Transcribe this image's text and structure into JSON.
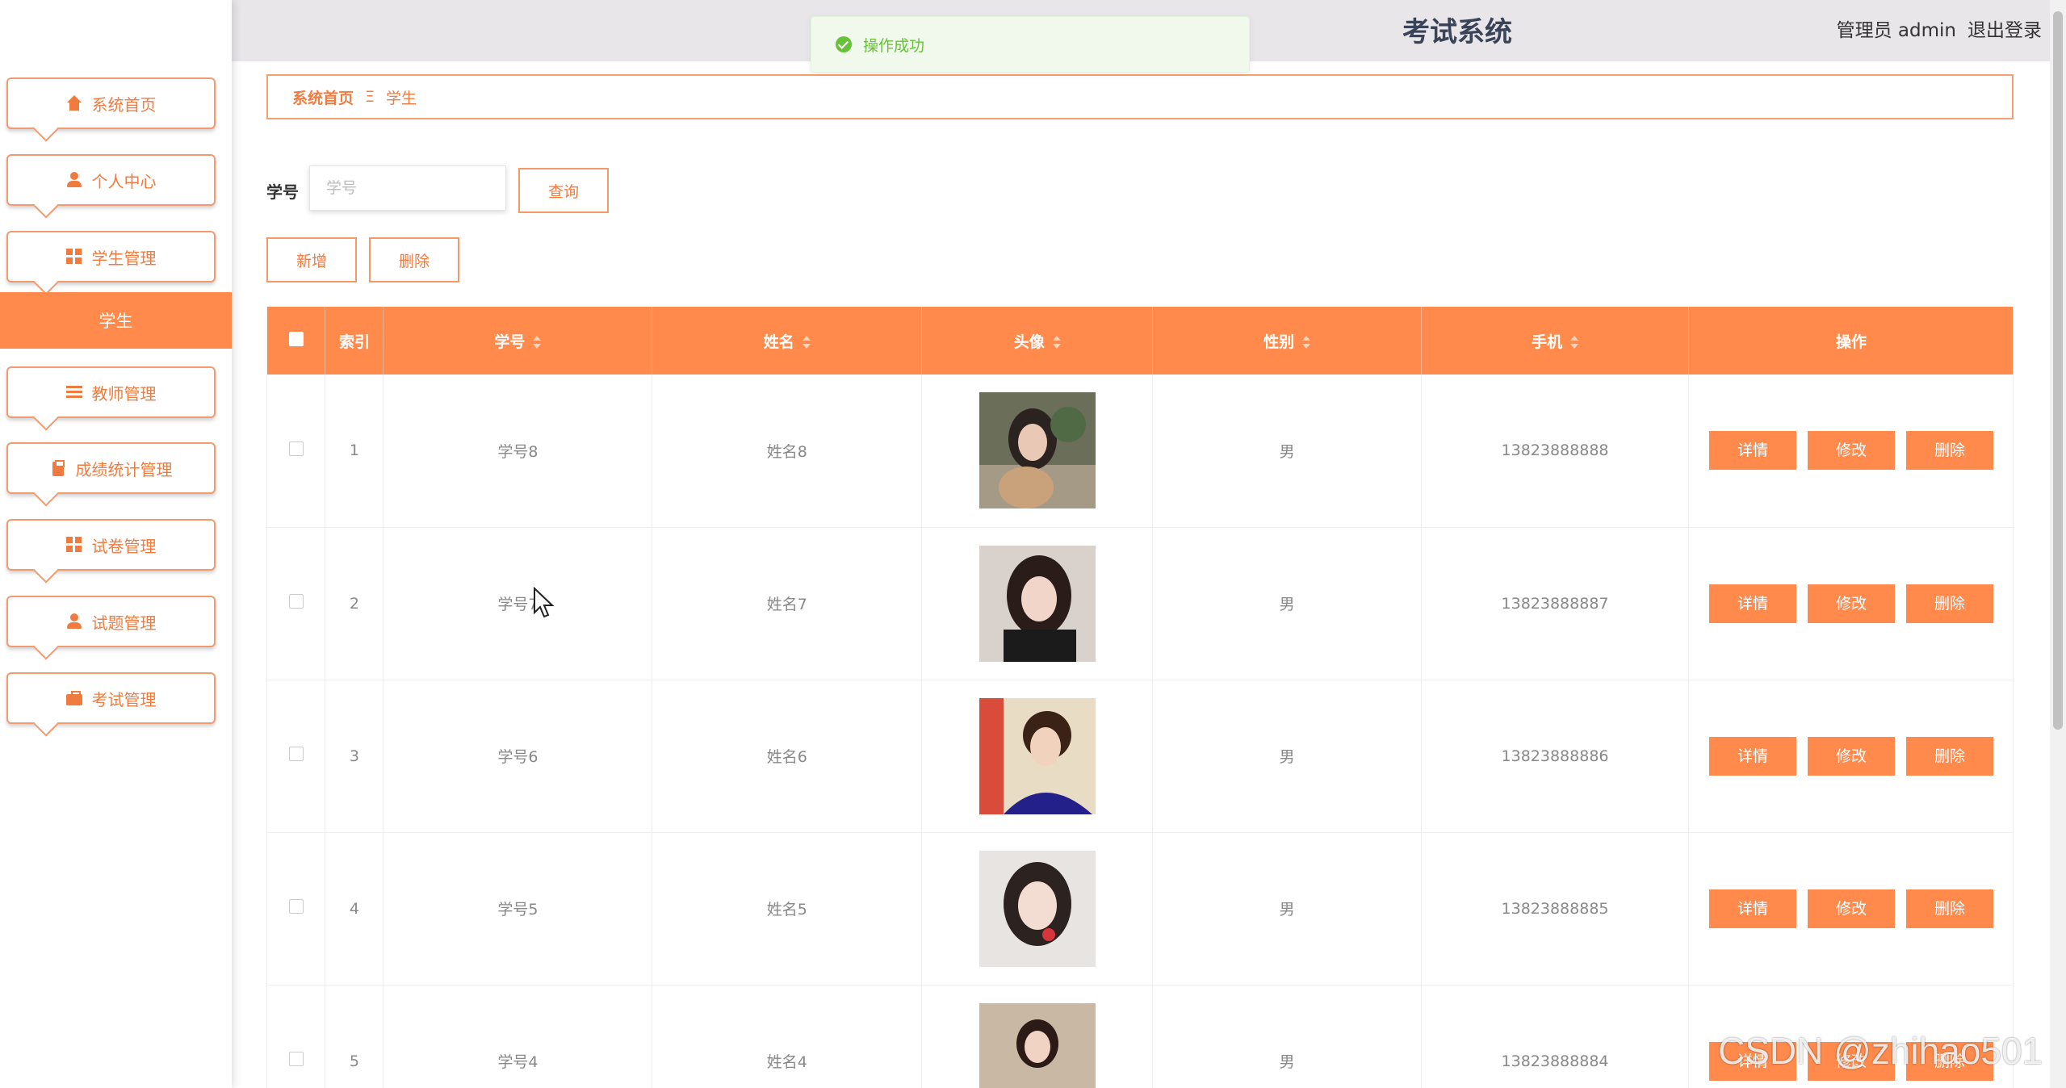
{
  "header": {
    "title": "考试系统",
    "user_label": "管理员 admin",
    "logout_label": "退出登录"
  },
  "toast": {
    "message": "操作成功"
  },
  "sidebar": {
    "items": [
      {
        "label": "系统首页",
        "icon": "home-icon"
      },
      {
        "label": "个人中心",
        "icon": "user-icon"
      },
      {
        "label": "学生管理",
        "icon": "grid-icon"
      },
      {
        "label": "学生",
        "icon": ""
      },
      {
        "label": "教师管理",
        "icon": "list-icon"
      },
      {
        "label": "成绩统计管理",
        "icon": "clipboard-icon"
      },
      {
        "label": "试卷管理",
        "icon": "grid-icon"
      },
      {
        "label": "试题管理",
        "icon": "user-icon"
      },
      {
        "label": "考试管理",
        "icon": "briefcase-icon"
      }
    ]
  },
  "breadcrumb": {
    "home": "系统首页",
    "separator": "Ξ",
    "current": "学生"
  },
  "search": {
    "label": "学号",
    "placeholder": "学号",
    "value": "",
    "query_label": "查询"
  },
  "toolbar": {
    "add_label": "新增",
    "delete_label": "删除"
  },
  "table": {
    "headers": {
      "index": "索引",
      "student_id": "学号",
      "name": "姓名",
      "avatar": "头像",
      "gender": "性别",
      "phone": "手机",
      "actions": "操作"
    },
    "rows": [
      {
        "index": "1",
        "student_id": "学号8",
        "name": "姓名8",
        "gender": "男",
        "phone": "13823888888"
      },
      {
        "index": "2",
        "student_id": "学号7",
        "name": "姓名7",
        "gender": "男",
        "phone": "13823888887"
      },
      {
        "index": "3",
        "student_id": "学号6",
        "name": "姓名6",
        "gender": "男",
        "phone": "13823888886"
      },
      {
        "index": "4",
        "student_id": "学号5",
        "name": "姓名5",
        "gender": "男",
        "phone": "13823888885"
      },
      {
        "index": "5",
        "student_id": "学号4",
        "name": "姓名4",
        "gender": "男",
        "phone": "13823888884"
      }
    ],
    "action_labels": {
      "detail": "详情",
      "edit": "修改",
      "delete": "删除"
    }
  },
  "watermark": "CSDN @zhihao501",
  "colors": {
    "accent": "#ff8a4c",
    "accent_text": "#f07b3f",
    "success": "#67c23a"
  }
}
